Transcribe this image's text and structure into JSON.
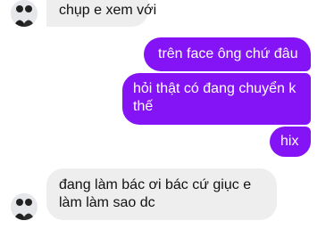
{
  "conversation": {
    "messages": [
      {
        "sender": "other",
        "text": "chụp e xem với"
      },
      {
        "sender": "me",
        "text": "trên face ông chứ đâu"
      },
      {
        "sender": "me",
        "text": "hỏi thật có đang chuyển k thế"
      },
      {
        "sender": "me",
        "text": "hix"
      },
      {
        "sender": "other",
        "text": "đang làm bác ơi bác cứ giục e làm làm sao dc"
      }
    ]
  },
  "colors": {
    "outgoing_bubble": "#8413f6",
    "incoming_bubble": "#eeeeef"
  },
  "icons": [
    "contact-avatar-icon"
  ]
}
